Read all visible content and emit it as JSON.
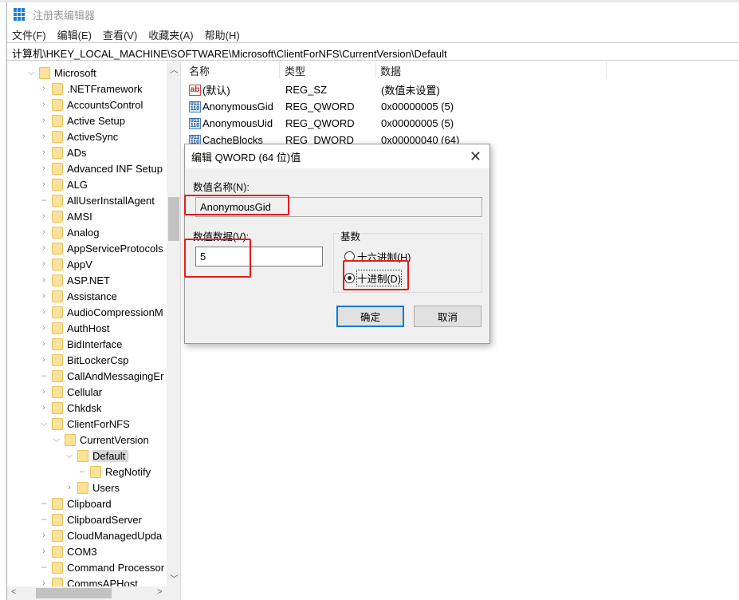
{
  "window": {
    "title": "注册表编辑器",
    "app_icon": "regedit-icon"
  },
  "menu": [
    "文件(F)",
    "编辑(E)",
    "查看(V)",
    "收藏夹(A)",
    "帮助(H)"
  ],
  "address": "计算机\\HKEY_LOCAL_MACHINE\\SOFTWARE\\Microsoft\\ClientForNFS\\CurrentVersion\\Default",
  "tree": [
    {
      "label": "Microsoft",
      "level": 0,
      "state": "expanded"
    },
    {
      "label": ".NETFramework",
      "level": 1,
      "state": "collapsed"
    },
    {
      "label": "AccountsControl",
      "level": 1,
      "state": "collapsed"
    },
    {
      "label": "Active Setup",
      "level": 1,
      "state": "collapsed"
    },
    {
      "label": "ActiveSync",
      "level": 1,
      "state": "collapsed"
    },
    {
      "label": "ADs",
      "level": 1,
      "state": "collapsed"
    },
    {
      "label": "Advanced INF Setup",
      "level": 1,
      "state": "collapsed"
    },
    {
      "label": "ALG",
      "level": 1,
      "state": "collapsed"
    },
    {
      "label": "AllUserInstallAgent",
      "level": 1,
      "state": "leaf"
    },
    {
      "label": "AMSI",
      "level": 1,
      "state": "collapsed"
    },
    {
      "label": "Analog",
      "level": 1,
      "state": "collapsed"
    },
    {
      "label": "AppServiceProtocols",
      "level": 1,
      "state": "collapsed"
    },
    {
      "label": "AppV",
      "level": 1,
      "state": "collapsed"
    },
    {
      "label": "ASP.NET",
      "level": 1,
      "state": "collapsed"
    },
    {
      "label": "Assistance",
      "level": 1,
      "state": "collapsed"
    },
    {
      "label": "AudioCompressionM",
      "level": 1,
      "state": "collapsed"
    },
    {
      "label": "AuthHost",
      "level": 1,
      "state": "collapsed"
    },
    {
      "label": "BidInterface",
      "level": 1,
      "state": "collapsed"
    },
    {
      "label": "BitLockerCsp",
      "level": 1,
      "state": "collapsed"
    },
    {
      "label": "CallAndMessagingEr",
      "level": 1,
      "state": "leaf"
    },
    {
      "label": "Cellular",
      "level": 1,
      "state": "collapsed"
    },
    {
      "label": "Chkdsk",
      "level": 1,
      "state": "collapsed"
    },
    {
      "label": "ClientForNFS",
      "level": 1,
      "state": "expanded"
    },
    {
      "label": "CurrentVersion",
      "level": 2,
      "state": "expanded"
    },
    {
      "label": "Default",
      "level": 3,
      "state": "expanded",
      "selected": true
    },
    {
      "label": "RegNotify",
      "level": 4,
      "state": "leaf"
    },
    {
      "label": "Users",
      "level": 3,
      "state": "collapsed"
    },
    {
      "label": "Clipboard",
      "level": 1,
      "state": "leaf"
    },
    {
      "label": "ClipboardServer",
      "level": 1,
      "state": "leaf"
    },
    {
      "label": "CloudManagedUpda",
      "level": 1,
      "state": "collapsed"
    },
    {
      "label": "COM3",
      "level": 1,
      "state": "collapsed"
    },
    {
      "label": "Command Processor",
      "level": 1,
      "state": "leaf"
    },
    {
      "label": "CommsAPHost",
      "level": 1,
      "state": "collapsed"
    }
  ],
  "list": {
    "columns": [
      "名称",
      "类型",
      "数据"
    ],
    "rows": [
      {
        "icon": "string-value-icon",
        "name": "(默认)",
        "type": "REG_SZ",
        "data": "(数值未设置)"
      },
      {
        "icon": "binary-value-icon",
        "name": "AnonymousGid",
        "type": "REG_QWORD",
        "data": "0x00000005 (5)"
      },
      {
        "icon": "binary-value-icon",
        "name": "AnonymousUid",
        "type": "REG_QWORD",
        "data": "0x00000005 (5)"
      },
      {
        "icon": "binary-value-icon",
        "name": "CacheBlocks",
        "type": "REG_DWORD",
        "data": "0x00000040 (64)"
      }
    ]
  },
  "dialog": {
    "title": "编辑 QWORD (64 位)值",
    "name_label": "数值名称(N):",
    "name_value": "AnonymousGid",
    "data_label": "数值数据(V):",
    "data_value": "5",
    "base_label": "基数",
    "hex_label": "十六进制(H)",
    "dec_label": "十进制(D)",
    "selected_base": "十进制(D)",
    "ok": "确定",
    "cancel": "取消"
  },
  "highlight_color": "#e51c1c",
  "accent": "#0078d7"
}
